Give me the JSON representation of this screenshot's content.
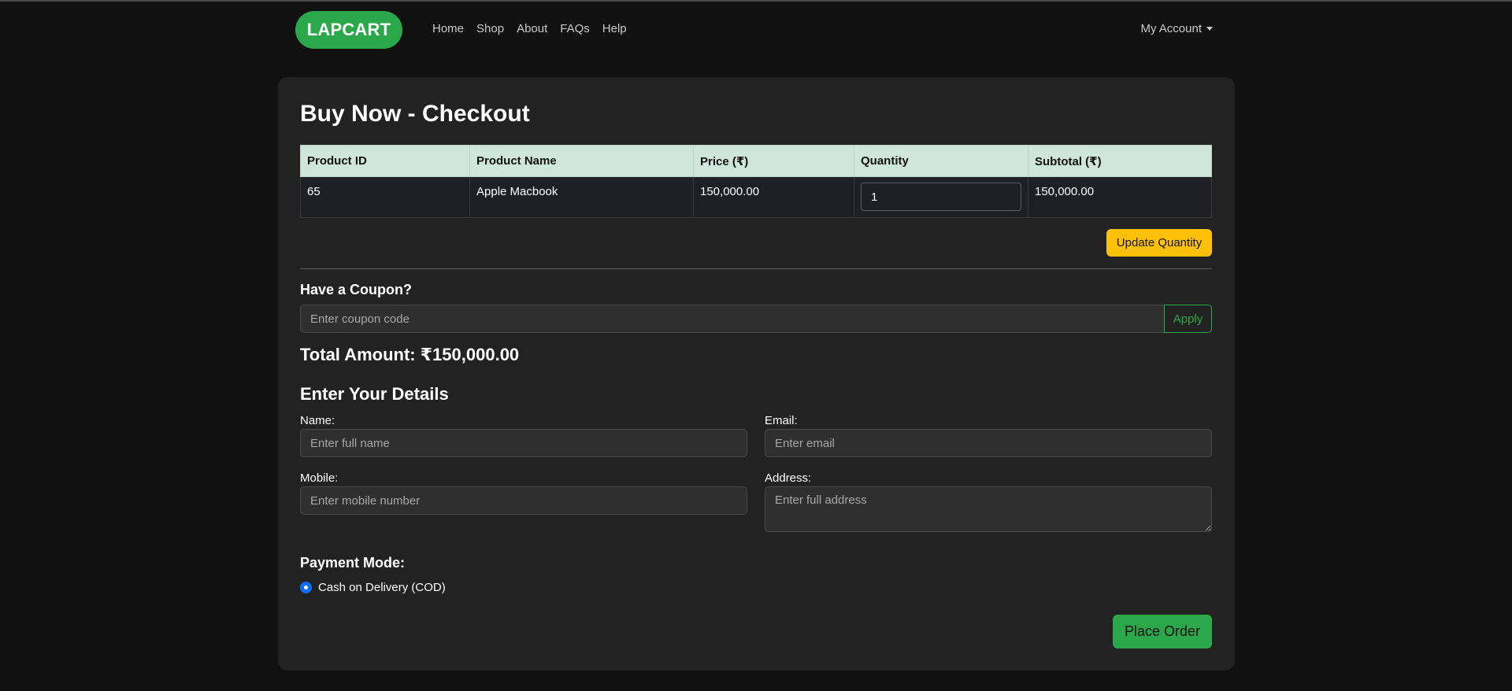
{
  "nav": {
    "brand": "LAPCART",
    "links": [
      "Home",
      "Shop",
      "About",
      "FAQs",
      "Help"
    ],
    "account": "My Account"
  },
  "page": {
    "title": "Buy Now - Checkout"
  },
  "table": {
    "headers": [
      "Product ID",
      "Product Name",
      "Price (₹)",
      "Quantity",
      "Subtotal (₹)"
    ],
    "rows": [
      {
        "product_id": "65",
        "product_name": "Apple Macbook",
        "price": "150,000.00",
        "quantity": "1",
        "subtotal": "150,000.00"
      }
    ]
  },
  "update_button": "Update Quantity",
  "coupon": {
    "heading": "Have a Coupon?",
    "placeholder": "Enter coupon code",
    "apply_label": "Apply"
  },
  "total": "Total Amount: ₹150,000.00",
  "details": {
    "heading": "Enter Your Details",
    "name_label": "Name:",
    "name_placeholder": "Enter full name",
    "email_label": "Email:",
    "email_placeholder": "Enter email",
    "mobile_label": "Mobile:",
    "mobile_placeholder": "Enter mobile number",
    "address_label": "Address:",
    "address_placeholder": "Enter full address"
  },
  "payment": {
    "heading": "Payment Mode:",
    "option": "Cash on Delivery (COD)",
    "selected": true
  },
  "place_order": "Place Order",
  "colors": {
    "brand_green": "#2aa84a",
    "warning_yellow": "#ffc107",
    "radio_blue": "#0d6efd",
    "table_header": "#cfe6da"
  }
}
